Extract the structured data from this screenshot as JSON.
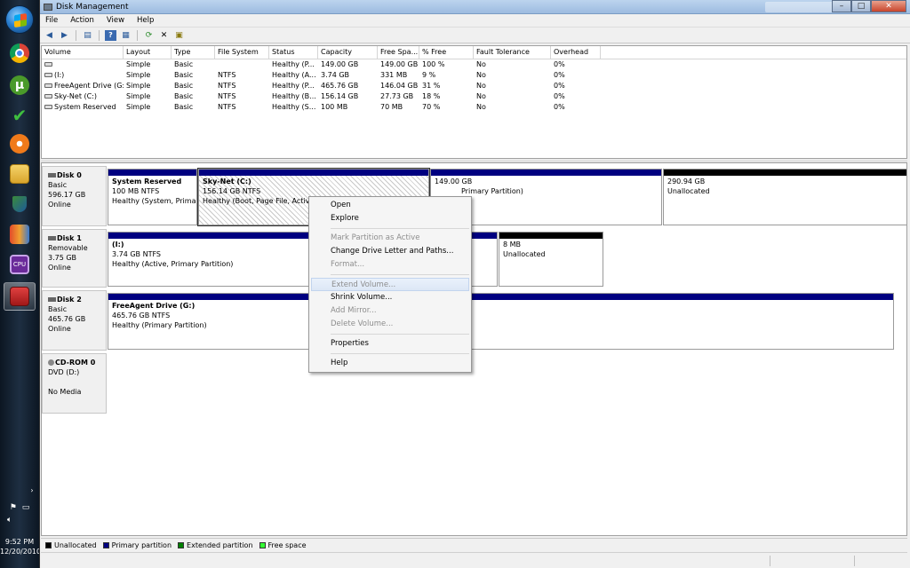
{
  "window": {
    "title": "Disk Management",
    "minimize": "–",
    "maximize": "□",
    "close": "✕"
  },
  "menu": [
    "File",
    "Action",
    "View",
    "Help"
  ],
  "toolbar": [
    "back-icon",
    "forward-icon",
    "panel-icon",
    "help-icon",
    "view-icon",
    "refresh-icon",
    "delete-icon",
    "properties-icon"
  ],
  "volume_table": {
    "columns": [
      "Volume",
      "Layout",
      "Type",
      "File System",
      "Status",
      "Capacity",
      "Free Spa...",
      "% Free",
      "Fault Tolerance",
      "Overhead"
    ],
    "rows": [
      [
        "",
        "Simple",
        "Basic",
        "",
        "Healthy (P...",
        "149.00 GB",
        "149.00 GB",
        "100 %",
        "No",
        "0%"
      ],
      [
        "(I:)",
        "Simple",
        "Basic",
        "NTFS",
        "Healthy (A...",
        "3.74 GB",
        "331 MB",
        "9 %",
        "No",
        "0%"
      ],
      [
        "FreeAgent Drive (G:)",
        "Simple",
        "Basic",
        "NTFS",
        "Healthy (P...",
        "465.76 GB",
        "146.04 GB",
        "31 %",
        "No",
        "0%"
      ],
      [
        "Sky-Net (C:)",
        "Simple",
        "Basic",
        "NTFS",
        "Healthy (B...",
        "156.14 GB",
        "27.73 GB",
        "18 %",
        "No",
        "0%"
      ],
      [
        "System Reserved",
        "Simple",
        "Basic",
        "NTFS",
        "Healthy (S...",
        "100 MB",
        "70 MB",
        "70 %",
        "No",
        "0%"
      ]
    ]
  },
  "disks": [
    {
      "name": "Disk 0",
      "type": "Basic",
      "size": "596.17 GB",
      "state": "Online",
      "partitions": [
        {
          "name": "System Reserved",
          "size": "100 MB NTFS",
          "status": "Healthy (System, Primar"
        },
        {
          "name": "Sky-Net  (C:)",
          "size": "156.14 GB NTFS",
          "status": "Healthy (Boot, Page File, Active,"
        },
        {
          "name": "",
          "size": "149.00 GB",
          "status": "Primary Partition)"
        },
        {
          "name": "",
          "size": "290.94 GB",
          "status": "Unallocated"
        }
      ]
    },
    {
      "name": "Disk 1",
      "type": "Removable",
      "size": "3.75 GB",
      "state": "Online",
      "partitions": [
        {
          "name": "(I:)",
          "size": "3.74 GB NTFS",
          "status": "Healthy (Active, Primary Partition)"
        },
        {
          "name": "",
          "size": "8 MB",
          "status": "Unallocated"
        }
      ]
    },
    {
      "name": "Disk 2",
      "type": "Basic",
      "size": "465.76 GB",
      "state": "Online",
      "partitions": [
        {
          "name": "FreeAgent Drive  (G:)",
          "size": "465.76 GB NTFS",
          "status": "Healthy (Primary Partition)"
        }
      ]
    },
    {
      "name": "CD-ROM 0",
      "type": "DVD (D:)",
      "size": "",
      "state": "No Media",
      "partitions": []
    }
  ],
  "context_menu": [
    {
      "label": "Open",
      "enabled": true
    },
    {
      "label": "Explore",
      "enabled": true
    },
    {
      "sep": true
    },
    {
      "label": "Mark Partition as Active",
      "enabled": false
    },
    {
      "label": "Change Drive Letter and Paths...",
      "enabled": true
    },
    {
      "label": "Format...",
      "enabled": false
    },
    {
      "sep": true
    },
    {
      "label": "Extend Volume...",
      "enabled": false,
      "highlighted": true
    },
    {
      "label": "Shrink Volume...",
      "enabled": true
    },
    {
      "label": "Add Mirror...",
      "enabled": false
    },
    {
      "label": "Delete Volume...",
      "enabled": false
    },
    {
      "sep": true
    },
    {
      "label": "Properties",
      "enabled": true
    },
    {
      "sep": true
    },
    {
      "label": "Help",
      "enabled": true
    }
  ],
  "legend": [
    {
      "label": "Unallocated",
      "color": "#000000"
    },
    {
      "label": "Primary partition",
      "color": "#000080"
    },
    {
      "label": "Extended partition",
      "color": "#008000"
    },
    {
      "label": "Free space",
      "color": "#33ff33"
    }
  ],
  "colors": {
    "primary_bar": "#000080",
    "unallocated_bar": "#000000"
  },
  "taskbar": {
    "apps": [
      "chrome-icon",
      "utorrent-icon",
      "checkmark-app-icon",
      "avast-icon",
      "explorer-icon",
      "security-icon",
      "media-icon",
      "cpu-z-icon",
      "disk-management-icon"
    ],
    "time": "9:52 PM",
    "date": "12/20/2010"
  }
}
